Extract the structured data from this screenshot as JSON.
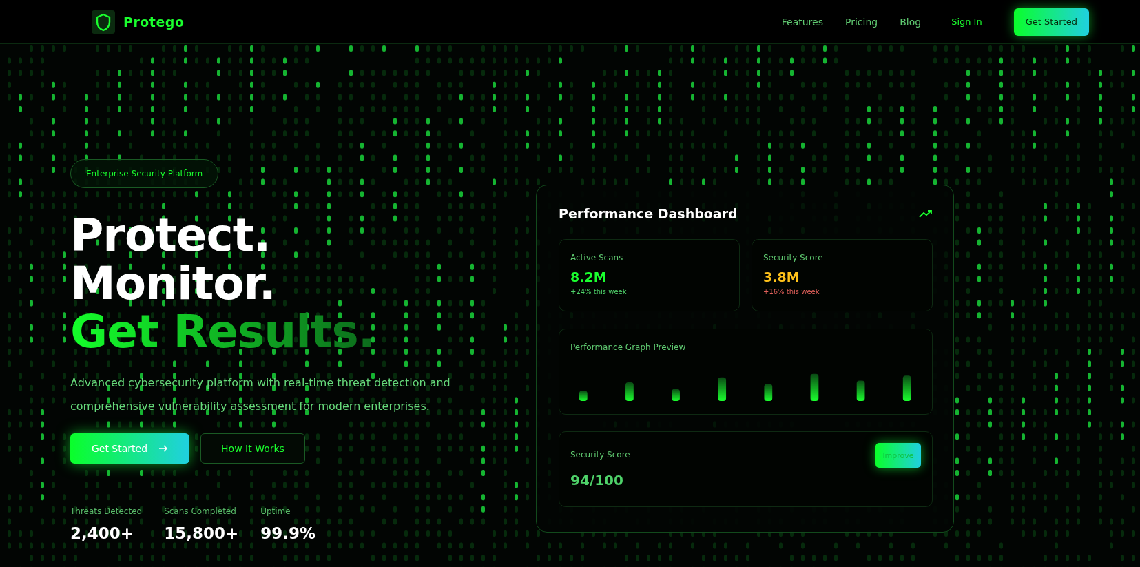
{
  "header": {
    "brand": "Protego",
    "nav": [
      {
        "label": "Features"
      },
      {
        "label": "Pricing"
      },
      {
        "label": "Blog"
      }
    ],
    "sign_in": "Sign In",
    "cta": "Get Started"
  },
  "hero": {
    "badge": "Enterprise Security Platform",
    "headline": [
      {
        "text": "Protect.",
        "kind": "plain"
      },
      {
        "text": "Monitor.",
        "kind": "plain"
      },
      {
        "text": "Get Results.",
        "kind": "accent"
      }
    ],
    "description": "Advanced cybersecurity platform with real-time threat detection and comprehensive vulnerability assessment for modern enterprises.",
    "primary_button": "Get Started",
    "secondary_button": "How It Works",
    "stats": [
      {
        "label": "Threats Detected",
        "value": "2,400+"
      },
      {
        "label": "Scans Completed",
        "value": "15,800+"
      },
      {
        "label": "Uptime",
        "value": "99.9%"
      }
    ]
  },
  "dashboard": {
    "title": "Performance Dashboard",
    "metrics": [
      {
        "label": "Active Scans",
        "value": "8.2M",
        "change": "+24% this week",
        "color": "#1aff2e"
      },
      {
        "label": "Security Score",
        "value": "3.8M",
        "change": "+16% this week",
        "color": "#ffc21a"
      }
    ],
    "graph": {
      "title": "Performance Graph Preview"
    },
    "score": {
      "label": "Security Score",
      "value": "94/100",
      "button": "Improve"
    }
  }
}
